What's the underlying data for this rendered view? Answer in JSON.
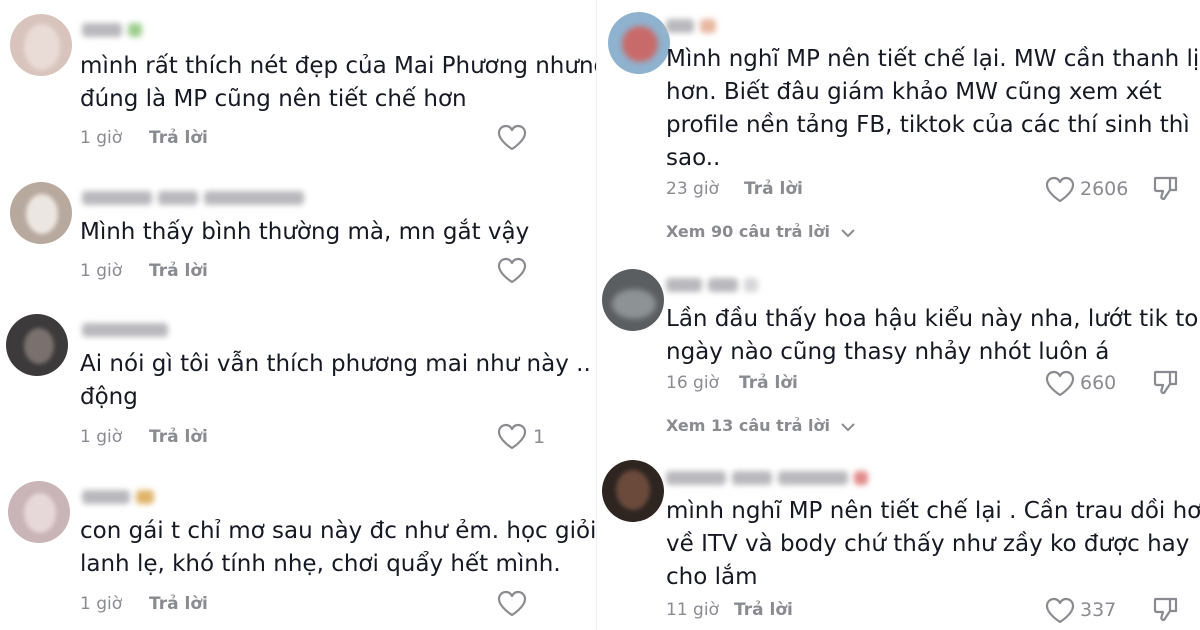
{
  "left_comments": [
    {
      "username": "Mi",
      "text_lines": [
        "mình rất thích nét đẹp của Mai Phương nhưng",
        "đúng là MP cũng nên tiết chế hơn"
      ],
      "time": "1 giờ",
      "reply_label": "Trả lời",
      "likes": ""
    },
    {
      "username": "Hoàng Thị Hoàng Nhung",
      "text_lines": [
        "Mình thấy bình thường mà, mn gắt vậy"
      ],
      "time": "1 giờ",
      "reply_label": "Trả lời",
      "likes": ""
    },
    {
      "username": "Loughan",
      "text_lines": [
        "Ai nói gì tôi vẫn thích phương mai như này .. n",
        "động"
      ],
      "time": "1 giờ",
      "reply_label": "Trả lời",
      "likes": "1"
    },
    {
      "username": "Kiều",
      "text_lines": [
        "con gái t chỉ mơ sau này đc như ẻm. học giỏi,",
        "lanh lẹ, khó tính nhẹ, chơi quẩy hết mình."
      ],
      "time": "1 giờ",
      "reply_label": "Trả lời",
      "likes": ""
    }
  ],
  "right_comments": [
    {
      "username": "Vy",
      "text_lines": [
        "Mình nghĩ MP nên tiết chế lại. MW cần thanh lịch",
        "hơn. Biết đâu giám khảo MW cũng xem xét",
        "profile nền tảng FB, tiktok của các thí sinh thì",
        "sao.."
      ],
      "time": "23 giờ",
      "reply_label": "Trả lời",
      "likes": "2606",
      "view_replies": "Xem 90 câu trả lời"
    },
    {
      "username": "Thu Hiền",
      "text_lines": [
        "Lần đầu thấy hoa hậu kiểu này nha, lướt tik tok",
        "ngày nào cũng thasy nhảy nhót luôn á"
      ],
      "time": "16 giờ",
      "reply_label": "Trả lời",
      "likes": "660",
      "view_replies": "Xem 13 câu trả lời"
    },
    {
      "username": "Nhung Hiền Hồ Hương",
      "text_lines": [
        "mình nghĩ MP nên tiết chế lại . Cần trau dồi hơn",
        "về ITV và body chứ thấy như zầy ko được hay",
        "cho lắm"
      ],
      "time": "11 giờ",
      "reply_label": "Trả lời",
      "likes": "337"
    }
  ],
  "colors": {
    "text": "#161823",
    "meta": "#8a8b91",
    "background": "#ffffff"
  },
  "icons": {
    "like": "heart-outline-icon",
    "dislike": "thumbs-down-icon",
    "expand": "chevron-down-icon"
  }
}
